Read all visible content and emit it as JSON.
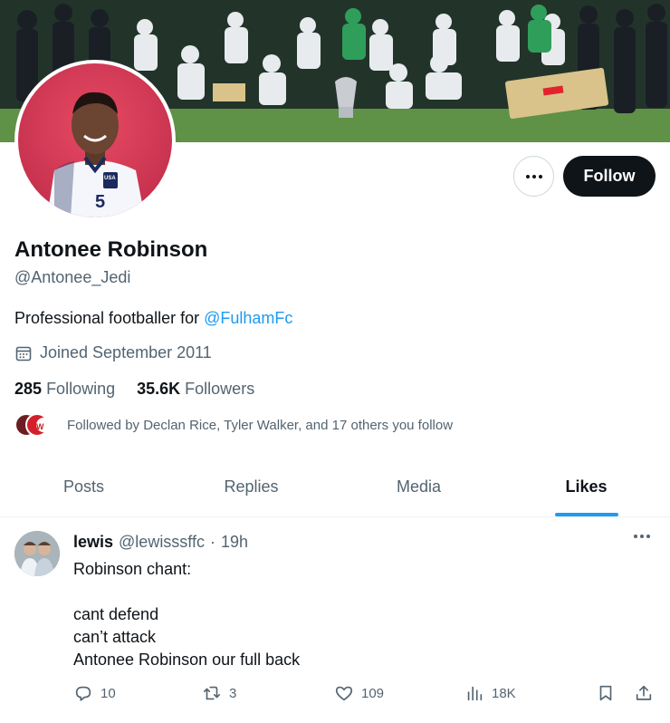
{
  "profile": {
    "name": "Antonee Robinson",
    "handle": "@Antonee_Jedi",
    "bio_prefix": "Professional footballer for ",
    "bio_mention": "@FulhamFc",
    "joined": "Joined September 2011",
    "following_count": "285",
    "following_label": "Following",
    "followers_count": "35.6K",
    "followers_label": "Followers",
    "followed_by": "Followed by Declan Rice, Tyler Walker, and 17 others you follow",
    "jersey_number": "5",
    "crest_text": "USA"
  },
  "buttons": {
    "follow": "Follow"
  },
  "tabs": [
    {
      "label": "Posts"
    },
    {
      "label": "Replies"
    },
    {
      "label": "Media"
    },
    {
      "label": "Likes",
      "active": true
    }
  ],
  "tweet": {
    "display_name": "lewis",
    "username": "@lewisssffc",
    "separator": "·",
    "time": "19h",
    "lines": [
      "Robinson chant:",
      "",
      "cant defend",
      "can’t attack",
      "Antonee Robinson our full back"
    ],
    "replies": "10",
    "reposts": "3",
    "likes": "109",
    "views": "18K"
  },
  "icons": [
    "more-icon",
    "calendar-icon",
    "reply-icon",
    "repost-icon",
    "like-icon",
    "views-icon",
    "bookmark-icon",
    "share-icon"
  ],
  "colors": {
    "accent": "#1d9bf0",
    "text": "#0f1419",
    "muted": "#536471",
    "follow_bg": "#0f1419",
    "avatar_bg": "#d23b55"
  }
}
